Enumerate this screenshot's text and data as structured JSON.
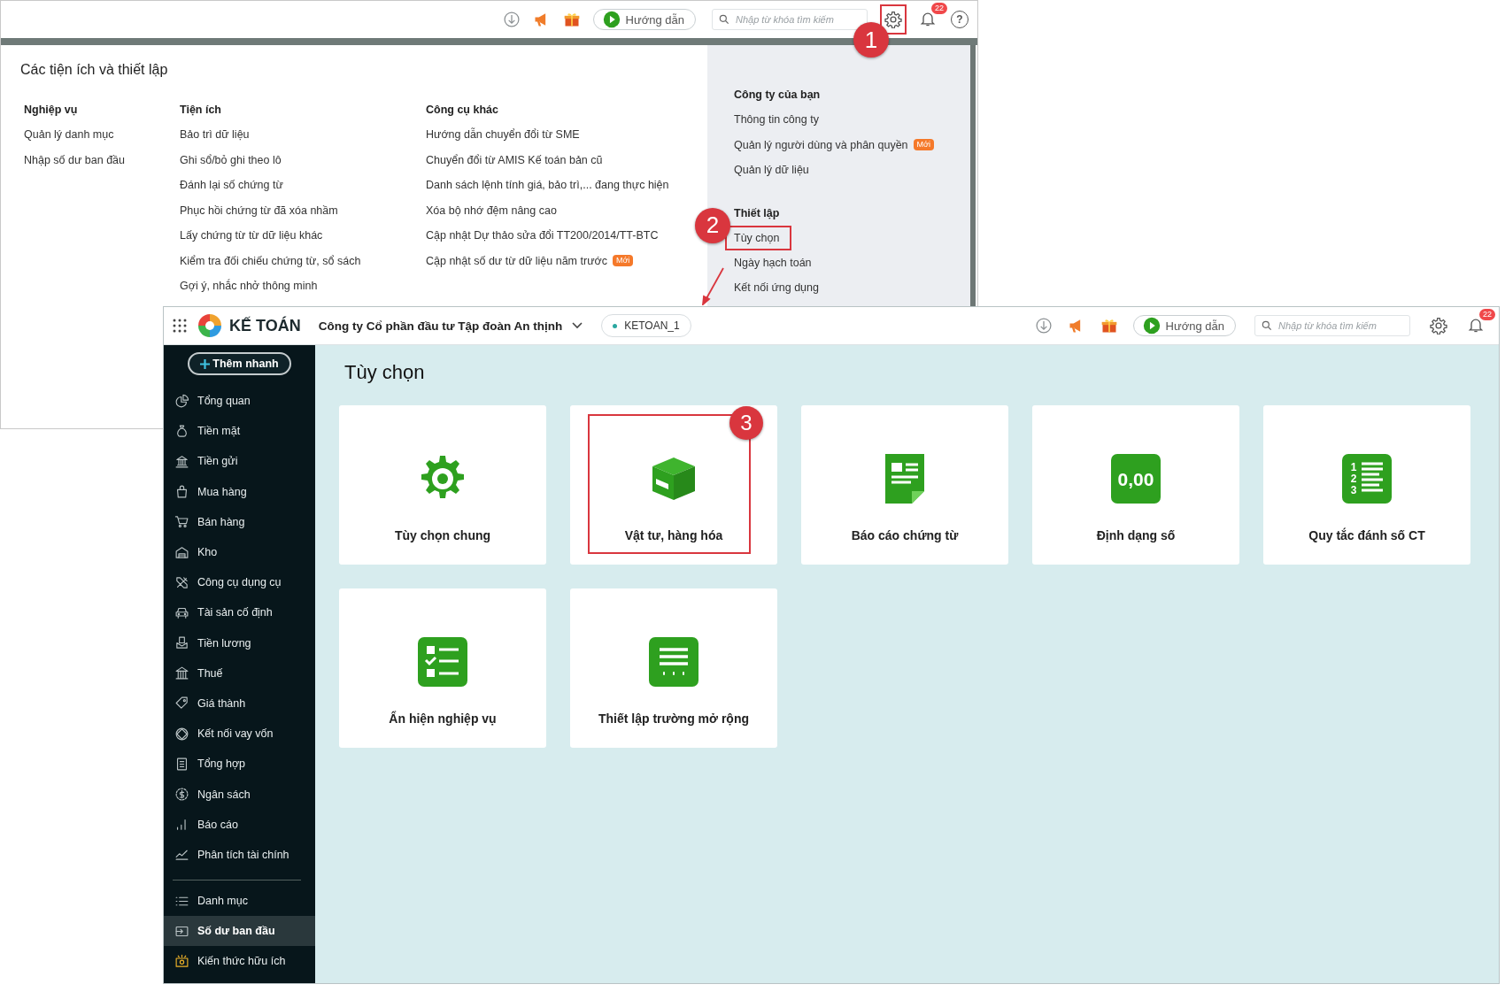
{
  "settings_window": {
    "toolbar": {
      "guide_button": "Hướng dẫn",
      "search_placeholder": "Nhập từ khóa tìm kiếm",
      "notification_count": "22",
      "help_glyph": "?",
      "settings_annotation": "1"
    },
    "title": "Các tiện ích và thiết lập",
    "columns": [
      {
        "heading": "Nghiệp vụ",
        "items": [
          {
            "label": "Quản lý danh mục"
          },
          {
            "label": "Nhập số dư ban đầu"
          }
        ]
      },
      {
        "heading": "Tiện ích",
        "items": [
          {
            "label": "Bảo trì dữ liệu"
          },
          {
            "label": "Ghi sổ/bỏ ghi theo lô"
          },
          {
            "label": "Đánh lại số chứng từ"
          },
          {
            "label": "Phục hồi chứng từ đã xóa nhầm"
          },
          {
            "label": "Lấy chứng từ từ dữ liệu khác"
          },
          {
            "label": "Kiểm tra đối chiếu chứng từ, sổ sách"
          },
          {
            "label": "Gợi ý, nhắc nhở thông minh"
          }
        ]
      },
      {
        "heading": "Công cụ khác",
        "items": [
          {
            "label": "Hướng dẫn chuyển đổi từ SME"
          },
          {
            "label": "Chuyển đổi từ AMIS Kế toán bản cũ"
          },
          {
            "label": "Danh sách lệnh tính giá, bảo trì,... đang thực hiện"
          },
          {
            "label": "Xóa bộ nhớ đệm nâng cao"
          },
          {
            "label": "Cập nhật Dự thảo sửa đổi TT200/2014/TT-BTC"
          },
          {
            "label": "Cập nhật số dư từ dữ liệu năm trước",
            "badge": "Mới"
          }
        ]
      }
    ],
    "side_panel": [
      {
        "heading": "Công ty của bạn",
        "items": [
          {
            "label": "Thông tin công ty"
          },
          {
            "label": "Quản lý người dùng và phân quyền",
            "badge": "Mới"
          },
          {
            "label": "Quản lý dữ liệu"
          }
        ]
      },
      {
        "heading": "Thiết lập",
        "items": [
          {
            "label": "Tùy chọn",
            "annotation": "2"
          },
          {
            "label": "Ngày hạch toán"
          },
          {
            "label": "Kết nối ứng dụng"
          }
        ]
      }
    ]
  },
  "app_window": {
    "logo_text": "KẾ TOÁN",
    "company": "Công ty Cổ phần đầu tư Tập đoàn An thịnh",
    "database": "KETOAN_1",
    "toolbar": {
      "guide_button": "Hướng dẫn",
      "search_placeholder": "Nhập từ khóa tìm kiếm",
      "notification_count": "22"
    },
    "quick_add": "Thêm nhanh",
    "sidebar": {
      "groups": [
        {
          "items": [
            {
              "label": "Tổng quan",
              "selected": false
            },
            {
              "label": "Tiền mặt",
              "selected": false
            },
            {
              "label": "Tiền gửi",
              "selected": false
            },
            {
              "label": "Mua hàng",
              "selected": false
            },
            {
              "label": "Bán hàng",
              "selected": false
            },
            {
              "label": "Kho",
              "selected": false
            },
            {
              "label": "Công cụ dụng cụ",
              "selected": false
            },
            {
              "label": "Tài sản cố định",
              "selected": false
            },
            {
              "label": "Tiền lương",
              "selected": false
            },
            {
              "label": "Thuế",
              "selected": false
            },
            {
              "label": "Giá thành",
              "selected": false
            },
            {
              "label": "Kết nối vay vốn",
              "selected": false
            },
            {
              "label": "Tổng hợp",
              "selected": false
            },
            {
              "label": "Ngân sách",
              "selected": false
            },
            {
              "label": "Báo cáo",
              "selected": false
            },
            {
              "label": "Phân tích tài chính",
              "selected": false
            }
          ]
        },
        {
          "items": [
            {
              "label": "Danh mục",
              "selected": false
            },
            {
              "label": "Số dư ban đầu",
              "selected": true
            },
            {
              "label": "Kiến thức hữu ích",
              "selected": false
            }
          ]
        }
      ]
    },
    "page_title": "Tùy chọn",
    "cards": [
      {
        "label": "Tùy chọn chung",
        "kind": "gear"
      },
      {
        "label": "Vật tư, hàng hóa",
        "kind": "box",
        "annotation": "3"
      },
      {
        "label": "Báo cáo chứng từ",
        "kind": "document"
      },
      {
        "label": "Định dạng số",
        "kind": "number",
        "icon_text": "0,00"
      },
      {
        "label": "Quy tắc đánh số CT",
        "kind": "numbered",
        "icon_text": "123"
      },
      {
        "label": "Ẩn hiện nghiệp vụ",
        "kind": "checklist"
      },
      {
        "label": "Thiết lập trường mở rộng",
        "kind": "fields"
      }
    ]
  }
}
